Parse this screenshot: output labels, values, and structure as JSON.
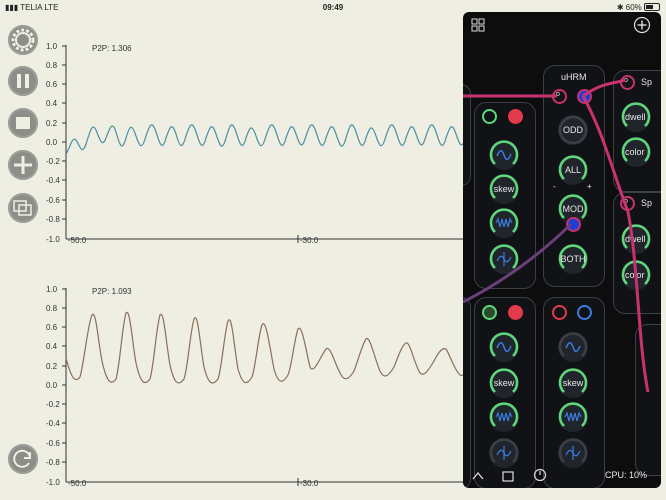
{
  "status_bar": {
    "carrier": "TELIA",
    "network": "LTE",
    "time": "09:49",
    "battery": "60%"
  },
  "scope_top": {
    "p2p_label": "P2P: 1.306",
    "y_ticks": [
      "1.0",
      "0.8",
      "0.6",
      "0.4",
      "0.2",
      "0.0",
      "-0.2",
      "-0.4",
      "-0.6",
      "-0.8",
      "-1.0"
    ],
    "x_ticks": [
      "-50.0",
      "-30.0"
    ],
    "trace_color": "#4b8fa0"
  },
  "scope_bottom": {
    "p2p_label": "P2P: 1.093",
    "y_ticks": [
      "1.0",
      "0.8",
      "0.6",
      "0.4",
      "0.2",
      "0.0",
      "-0.2",
      "-0.4",
      "-0.6",
      "-0.8",
      "-1.0"
    ],
    "x_ticks": [
      "-50.0",
      "-30.0"
    ],
    "trace_color": "#8a6f5c"
  },
  "panel": {
    "module_uhrm": {
      "title": "uHRM",
      "port_labels": [
        "o"
      ],
      "knobs": [
        "ODD",
        "ALL",
        "MOD",
        "BOTH"
      ],
      "mod_range": [
        "-",
        "+"
      ]
    },
    "module_right": {
      "labels": [
        "Sp",
        "dwell",
        "color"
      ],
      "port_label": "o"
    },
    "module_osc_a": {
      "knob_labels": [
        "skew"
      ]
    },
    "module_osc_b": {
      "knob_labels": [
        "skew"
      ]
    },
    "module_osc_c": {
      "knob_labels": [
        "skew"
      ]
    },
    "cpu": "CPU: 10%",
    "accent_green": "#5fd87a",
    "accent_blue": "#3a7de0",
    "accent_red": "#e23b4b",
    "cable_magenta": "#c8326e",
    "cable_purple": "#6a3f7a"
  }
}
